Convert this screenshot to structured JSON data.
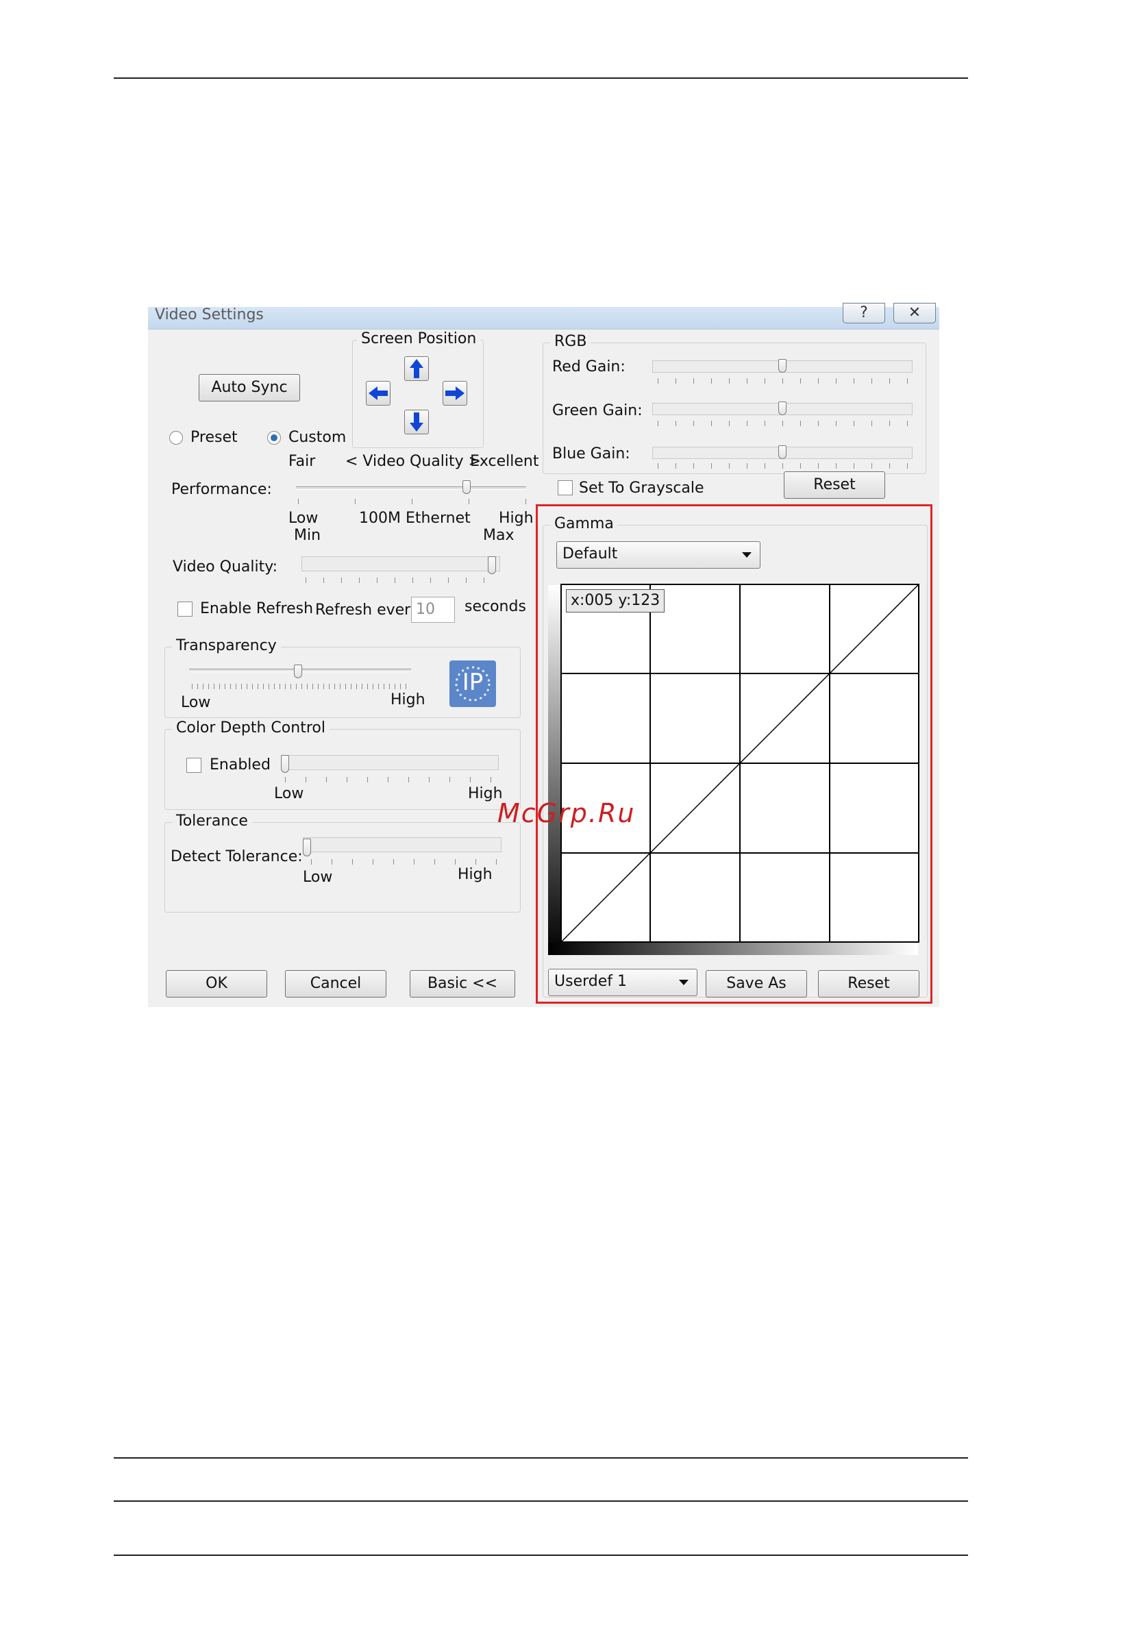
{
  "dialog": {
    "title": "Video Settings",
    "title_buttons": {
      "help": "?",
      "close": "✕"
    },
    "auto_sync": "Auto Sync",
    "screen_position": {
      "label": "Screen Position",
      "icons": [
        "arrow-up-icon",
        "arrow-left-icon",
        "arrow-right-icon",
        "arrow-down-icon"
      ]
    },
    "mode": {
      "preset": "Preset",
      "custom": "Custom",
      "selected": "Custom"
    },
    "quality_scale": {
      "fair": "Fair",
      "center": "< Video Quality >",
      "excellent": "Excellent"
    },
    "performance": {
      "label": "Performance:",
      "low": "Low",
      "min": "Min",
      "center": "100M Ethernet",
      "high": "High",
      "max": "Max",
      "level": 0.75
    },
    "video_quality": {
      "label": "Video Quality:",
      "level": 0.98
    },
    "refresh": {
      "enable_label": "Enable Refresh",
      "enabled": false,
      "every_label": "Refresh every",
      "value": "10",
      "unit": "seconds"
    },
    "transparency": {
      "label": "Transparency",
      "low": "Low",
      "high": "High",
      "level": 0.49,
      "icon": "ip-icon",
      "icon_text": "IP"
    },
    "color_depth": {
      "label": "Color Depth Control",
      "enabled_label": "Enabled",
      "enabled": false,
      "low": "Low",
      "high": "High",
      "level": 0.0
    },
    "tolerance": {
      "label": "Tolerance",
      "detect_label": "Detect Tolerance:",
      "low": "Low",
      "high": "High",
      "level": 0.0
    },
    "footer": {
      "ok": "OK",
      "cancel": "Cancel",
      "basic": "Basic <<"
    },
    "rgb": {
      "label": "RGB",
      "red_label": "Red Gain:",
      "red_level": 0.5,
      "green_label": "Green Gain:",
      "green_level": 0.5,
      "blue_label": "Blue Gain:",
      "blue_level": 0.5,
      "grayscale_label": "Set To Grayscale",
      "grayscale": false,
      "reset": "Reset"
    },
    "gamma": {
      "label": "Gamma",
      "preset": "Default",
      "coords": "x:005 y:123",
      "userdef": "Userdef 1",
      "save_as": "Save As",
      "reset": "Reset"
    }
  },
  "watermark": "McGrp.Ru",
  "highlight_color": "#e02424"
}
